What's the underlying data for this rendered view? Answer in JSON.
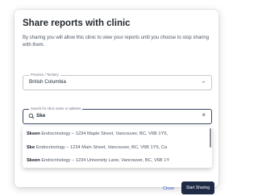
{
  "dialog": {
    "title": "Share reports with clinic",
    "description": "By sharing you will allow this clinic to view your reports until you choose to stop sharing with them."
  },
  "province": {
    "label": "Province / Territory",
    "value": "British Columbia",
    "chevron_icon": "chevron-down-icon"
  },
  "search": {
    "label": "Search for clinic name or address",
    "value": "Ske",
    "search_icon": "search-icon",
    "clear_icon": "close-icon",
    "clear_glyph": "×"
  },
  "results": [
    {
      "match": "Skeen",
      "rest": " Endocrinology – 1234 Maple Street, Vancouver, BC, V6B 1Y5,"
    },
    {
      "match": "Ske",
      "rest": " Endocrinology – 1234 Main Street, Vancouver, BC, V6B 1Y5, Ca"
    },
    {
      "match": "Skeen",
      "rest": " Endocrinology – 1234 University Lane, Vancouver, BC, V6B 1Y"
    }
  ],
  "actions": {
    "close_label": "Close",
    "primary_label": "Start Sharing"
  }
}
